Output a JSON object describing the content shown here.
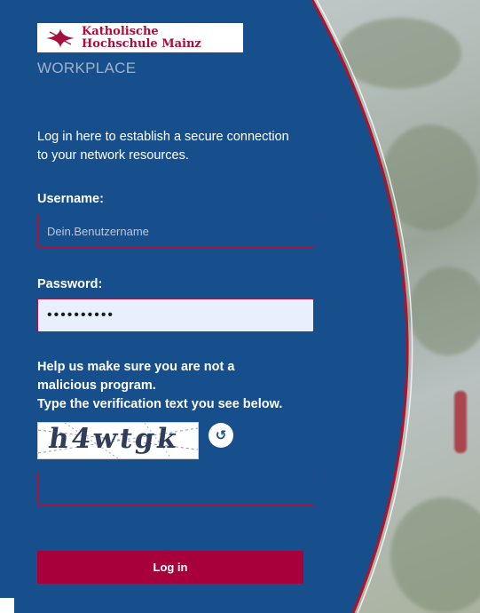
{
  "brand": {
    "logo_line1": "Katholische",
    "logo_line2": "Hochschule Mainz",
    "product": "WORKPLACE",
    "primary_color": "#174e8c",
    "accent_color": "#a8003a"
  },
  "intro": {
    "text": "Log in here to establish a secure connection to your network resources."
  },
  "username": {
    "label": "Username:",
    "placeholder": "Dein.Benutzername",
    "value": ""
  },
  "password": {
    "label": "Password:",
    "value": "••••••••••"
  },
  "verification": {
    "line1": "Help us make sure you are not a",
    "line2": "malicious program.",
    "line3": "Type the verification text you see below.",
    "captcha_text": "h4wtgk",
    "refresh_icon": "refresh-icon",
    "input_value": ""
  },
  "actions": {
    "login_label": "Log in"
  }
}
